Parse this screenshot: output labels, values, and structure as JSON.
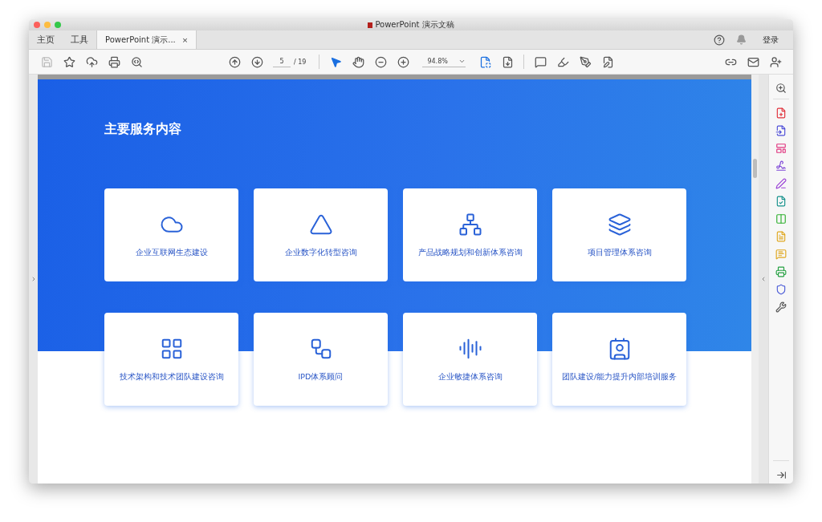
{
  "window": {
    "title": "PowerPoint 演示文稿"
  },
  "tabs": [
    {
      "label": "主页",
      "selected": false
    },
    {
      "label": "工具",
      "selected": false
    },
    {
      "label": "PowerPoint 演示...",
      "selected": true,
      "close": "×"
    }
  ],
  "account": {
    "label": "登录"
  },
  "toolbar": {
    "page": "5",
    "page_total": "/ 19",
    "zoom": "94.8%"
  },
  "slide": {
    "title": "主要服务内容",
    "services": [
      "企业互联网生态建设",
      "企业数字化转型咨询",
      "产品战略规划和创新体系咨询",
      "项目管理体系咨询",
      "技术架构和技术团队建设咨询",
      "IPD体系顾问",
      "企业敏捷体系咨询",
      "团队建设/能力提升内部培训服务"
    ]
  }
}
